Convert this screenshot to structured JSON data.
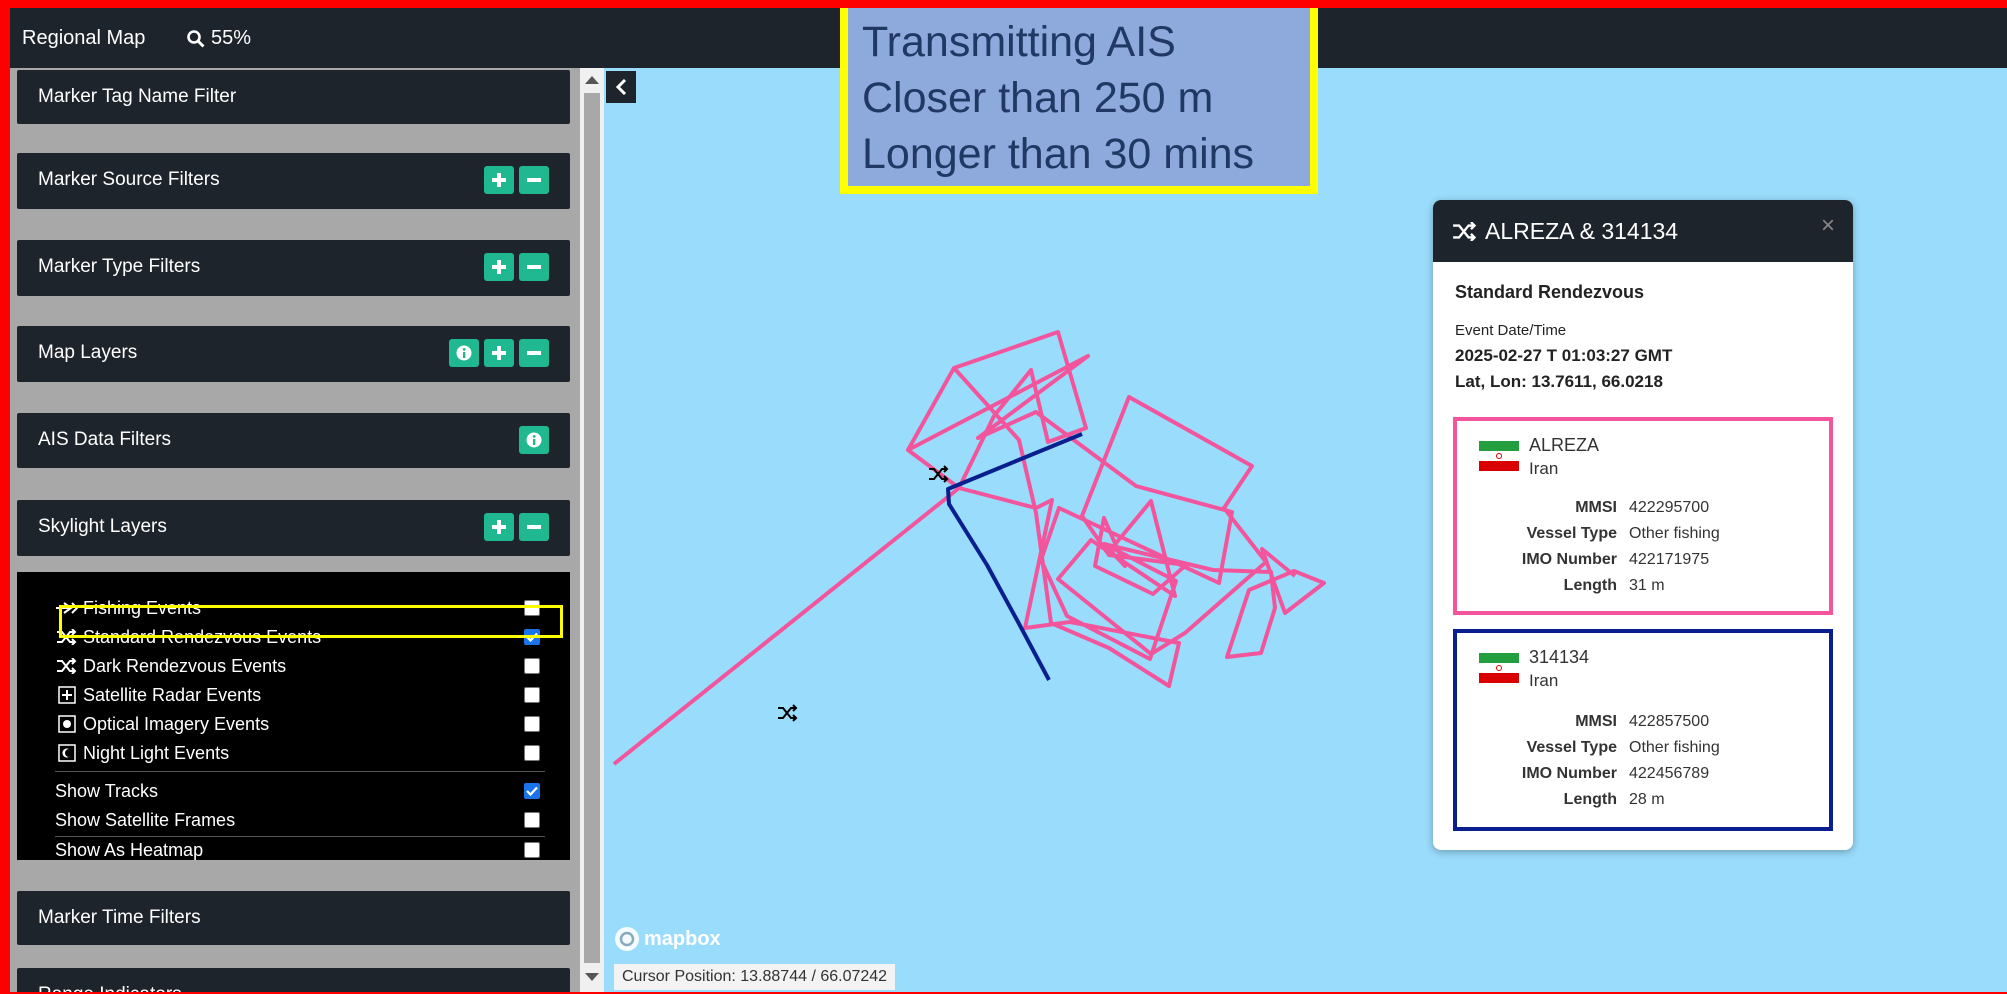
{
  "topbar": {
    "title": "Regional Map",
    "zoom": "55%"
  },
  "sidebar": {
    "panels": [
      {
        "label": "Marker Tag Name Filter"
      },
      {
        "label": "Marker Source Filters"
      },
      {
        "label": "Marker Type Filters"
      },
      {
        "label": "Map Layers"
      },
      {
        "label": "AIS Data Filters"
      },
      {
        "label": "Skylight Layers"
      },
      {
        "label": "Marker Time Filters"
      },
      {
        "label": "Range Indicators"
      }
    ],
    "skylight_items": [
      {
        "label": "Fishing Events",
        "checked": false,
        "icon": "fishing-icon"
      },
      {
        "label": "Standard Rendezvous Events",
        "checked": true,
        "icon": "shuffle-icon"
      },
      {
        "label": "Dark Rendezvous Events",
        "checked": false,
        "icon": "shuffle-icon"
      },
      {
        "label": "Satellite Radar Events",
        "checked": false,
        "icon": "radar-icon"
      },
      {
        "label": "Optical Imagery Events",
        "checked": false,
        "icon": "optical-icon"
      },
      {
        "label": "Night Light Events",
        "checked": false,
        "icon": "night-light-icon"
      },
      {
        "label": "Show Tracks",
        "checked": true
      },
      {
        "label": "Show Satellite Frames",
        "checked": false
      },
      {
        "label": "Show As Heatmap",
        "checked": false
      }
    ]
  },
  "map": {
    "attribution": "mapbox",
    "cursor_position": "Cursor Position: 13.88744 / 66.07242"
  },
  "annotation": {
    "lines": [
      "Transmitting AIS",
      "Closer than 250 m",
      "Longer than 30 mins"
    ]
  },
  "popup": {
    "title": "ALREZA & 314134",
    "event_type": "Standard Rendezvous",
    "datetime_label": "Event Date/Time",
    "datetime": "2025-02-27 T 01:03:27 GMT",
    "latlon": "Lat, Lon: 13.7611, 66.0218",
    "close": "×",
    "vessels": [
      {
        "name": "ALREZA",
        "country": "Iran",
        "border_color": "#f2559b",
        "fields": [
          {
            "k": "MMSI",
            "v": "422295700"
          },
          {
            "k": "Vessel Type",
            "v": "Other fishing"
          },
          {
            "k": "IMO Number",
            "v": "422171975"
          },
          {
            "k": "Length",
            "v": "31 m"
          }
        ]
      },
      {
        "name": "314134",
        "country": "Iran",
        "border_color": "#0a1f8f",
        "fields": [
          {
            "k": "MMSI",
            "v": "422857500"
          },
          {
            "k": "Vessel Type",
            "v": "Other fishing"
          },
          {
            "k": "IMO Number",
            "v": "422456789"
          },
          {
            "k": "Length",
            "v": "28 m"
          }
        ]
      }
    ]
  },
  "colors": {
    "track_pink": "#f2559b",
    "track_blue": "#0a1f8f",
    "accent": "#1fb890",
    "highlight": "#ffff00"
  }
}
